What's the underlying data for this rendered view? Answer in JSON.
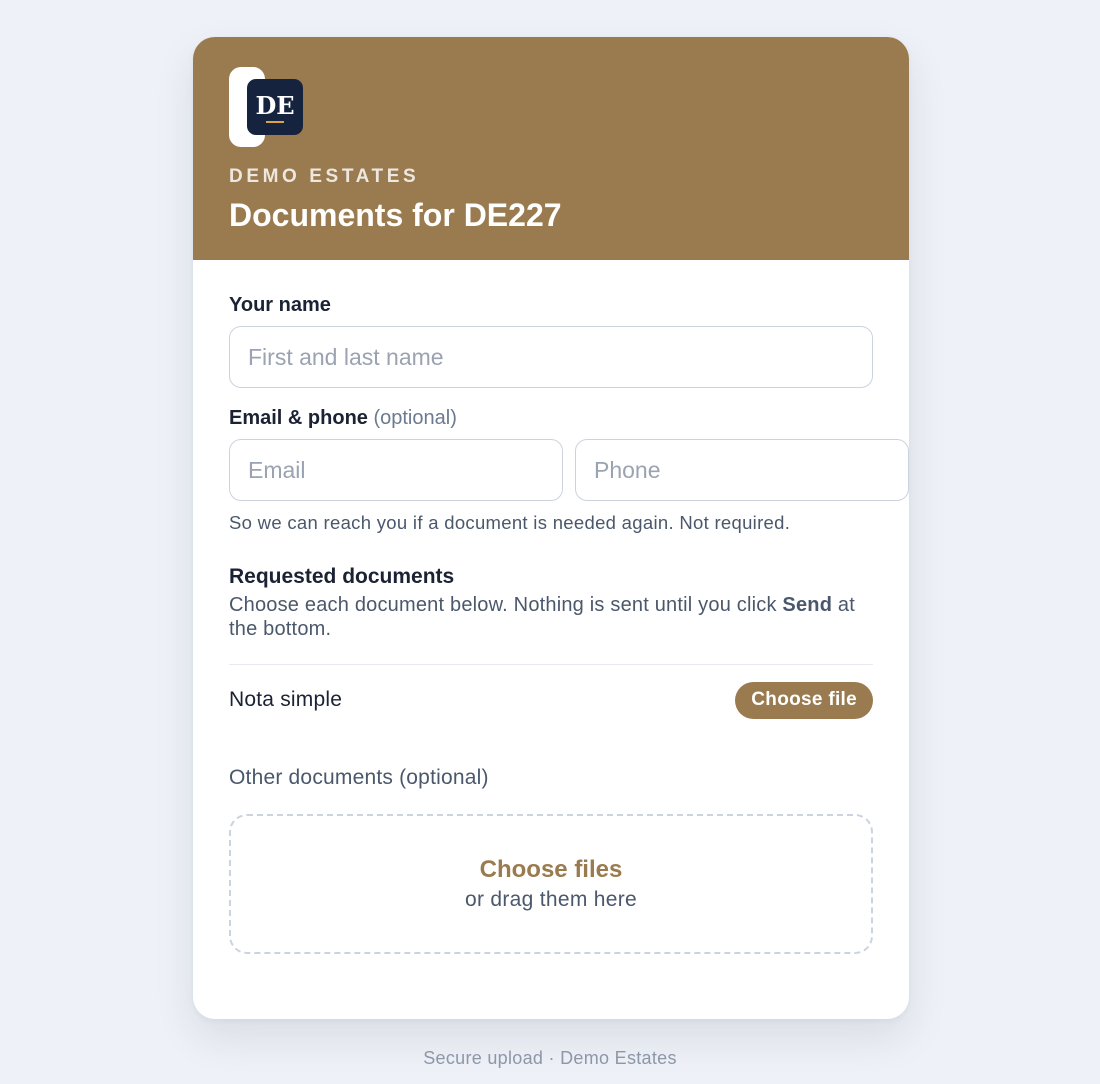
{
  "header": {
    "logo_text": "DE",
    "brand_name": "DEMO ESTATES",
    "title": "Documents for DE227"
  },
  "colors": {
    "brand": "#9a7b4f",
    "logo_bg": "#16233f",
    "logo_accent": "#d9a441",
    "page_bg": "#eef1f7"
  },
  "form": {
    "name_label": "Your name",
    "name_placeholder": "First and last name",
    "contact_label": "Email & phone",
    "contact_optional": "(optional)",
    "email_placeholder": "Email",
    "phone_placeholder": "Phone",
    "contact_helper": "So we can reach you if a document is needed again. Not required."
  },
  "requested": {
    "title": "Requested documents",
    "desc_before": "Choose each document below. Nothing is sent until you click ",
    "desc_bold": "Send",
    "desc_after": " at the bottom.",
    "items": [
      {
        "name": "Nota simple",
        "button_label": "Choose file"
      }
    ]
  },
  "other": {
    "label": "Other documents (optional)",
    "dropzone_primary": "Choose files",
    "dropzone_secondary": "or drag them here"
  },
  "footer": {
    "text": "Secure upload · Demo Estates"
  }
}
